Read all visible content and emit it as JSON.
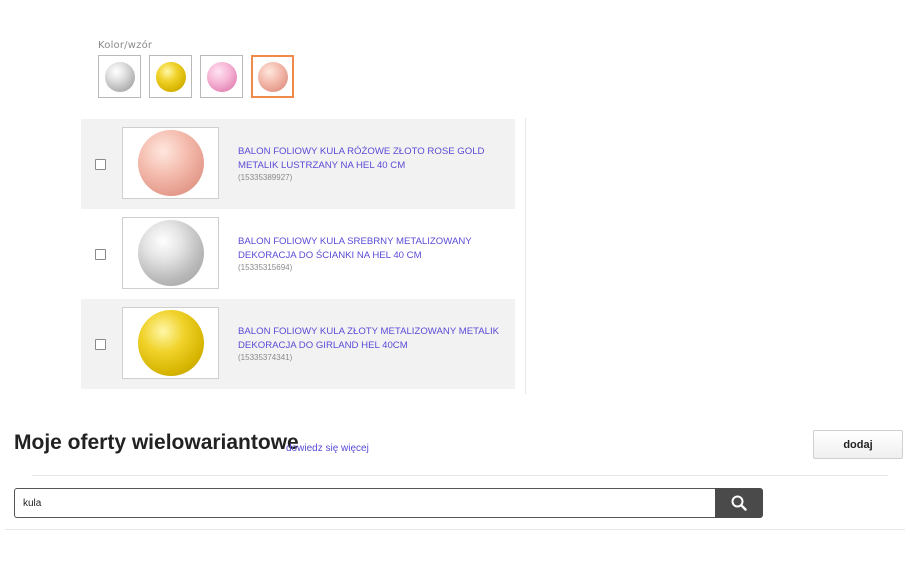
{
  "color_selector": {
    "label": "Kolor/wzór",
    "swatches": [
      {
        "name": "silver"
      },
      {
        "name": "gold"
      },
      {
        "name": "pink"
      },
      {
        "name": "rose-gold",
        "selected": true
      }
    ],
    "selected_border_color": "#f08a4b"
  },
  "products": [
    {
      "title": "BALON FOLIOWY KULA RÓŻOWE ZŁOTO ROSE GOLD METALIK LUSTRZANY NA HEL 40 CM",
      "id": "(15335389927)",
      "color": "rose-gold",
      "checked": false
    },
    {
      "title": "BALON FOLIOWY KULA SREBRNY METALIZOWANY DEKORACJA DO ŚCIANKI NA HEL 40 CM",
      "id": "(15335315694)",
      "color": "silver",
      "checked": false
    },
    {
      "title": "BALON FOLIOWY KULA ZŁOTY METALIZOWANY METALIK DEKORACJA DO GIRLAND HEL 40CM",
      "id": "(15335374341)",
      "color": "gold",
      "checked": false
    }
  ],
  "offers": {
    "title": "Moje oferty wielowariantowe",
    "learn_more": "dowiedz się więcej",
    "add_label": "dodaj"
  },
  "search": {
    "value": "kula",
    "icon": "search-icon"
  },
  "colors": {
    "link": "#5a4bd6",
    "row_shade": "#f2f2f2",
    "search_button": "#4a4a4a"
  }
}
